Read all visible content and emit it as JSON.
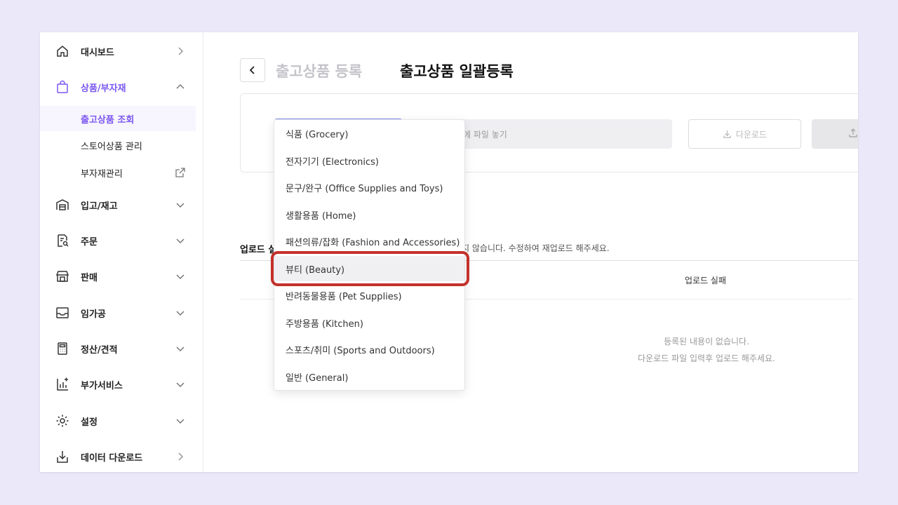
{
  "sidebar": {
    "items": [
      {
        "label": "대시보드"
      },
      {
        "label": "상품/부자재"
      },
      {
        "label": "입고/재고"
      },
      {
        "label": "주문"
      },
      {
        "label": "판매"
      },
      {
        "label": "임가공"
      },
      {
        "label": "정산/견적"
      },
      {
        "label": "부가서비스"
      },
      {
        "label": "설정"
      },
      {
        "label": "데이터 다운로드"
      }
    ],
    "subitems": [
      {
        "label": "출고상품 조회"
      },
      {
        "label": "스토어상품 관리"
      },
      {
        "label": "부자재관리"
      }
    ]
  },
  "header": {
    "breadcrumb_muted": "출고상품 등록",
    "title": "출고상품 일괄등록"
  },
  "upload": {
    "dropzone_text": "에 파일 놓기",
    "download_label": "다운로드"
  },
  "dropdown": {
    "options": [
      "식품 (Grocery)",
      "전자기기 (Electronics)",
      "문구/완구 (Office Supplies and Toys)",
      "생활용품 (Home)",
      "패션의류/잡화 (Fashion and Accessories)",
      "뷰티 (Beauty)",
      "반려동물용품 (Pet Supplies)",
      "주방용품 (Kitchen)",
      "스포츠/취미 (Sports and Outdoors)",
      "일반 (General)"
    ],
    "highlighted": "뷰티 (Beauty)"
  },
  "results": {
    "title": "업로드 실",
    "notice": "되지 않습니다. 수정하여 재업로드 해주세요.",
    "col_fail": "업로드 실패",
    "empty_line1": "등록된 내용이 없습니다.",
    "empty_line2": "다운로드 파일 입력후 업로드 해주세요."
  },
  "colors": {
    "accent": "#7b57f0",
    "highlight_ring": "#c4312b",
    "background": "#ebe9f9"
  }
}
